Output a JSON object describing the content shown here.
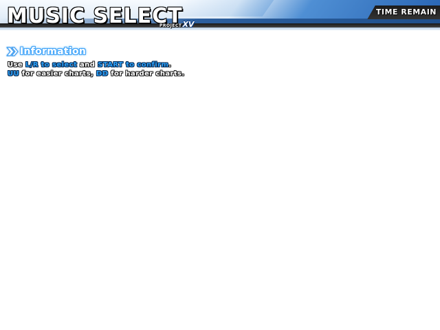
{
  "header": {
    "title": "MUSIC SELECT",
    "subtitle_small": "PROJECT",
    "subtitle_big": "XV",
    "time_remain_label": "TIME REMAIN"
  },
  "information": {
    "title": "Information",
    "line1": {
      "t1": "Use ",
      "h1": "L/R to select",
      "t2": " and ",
      "h2": "START to confirm",
      "t3": "."
    },
    "line2": {
      "h1": "UU",
      "t1": " for easier charts, ",
      "h2": "DD",
      "t2": " for harder charts."
    }
  },
  "colors": {
    "accent": "#2a9df4",
    "header_blue": "#2a66b4",
    "background": "#ffffff"
  },
  "icons": {
    "info_marker": "double-chevron-right-icon"
  }
}
